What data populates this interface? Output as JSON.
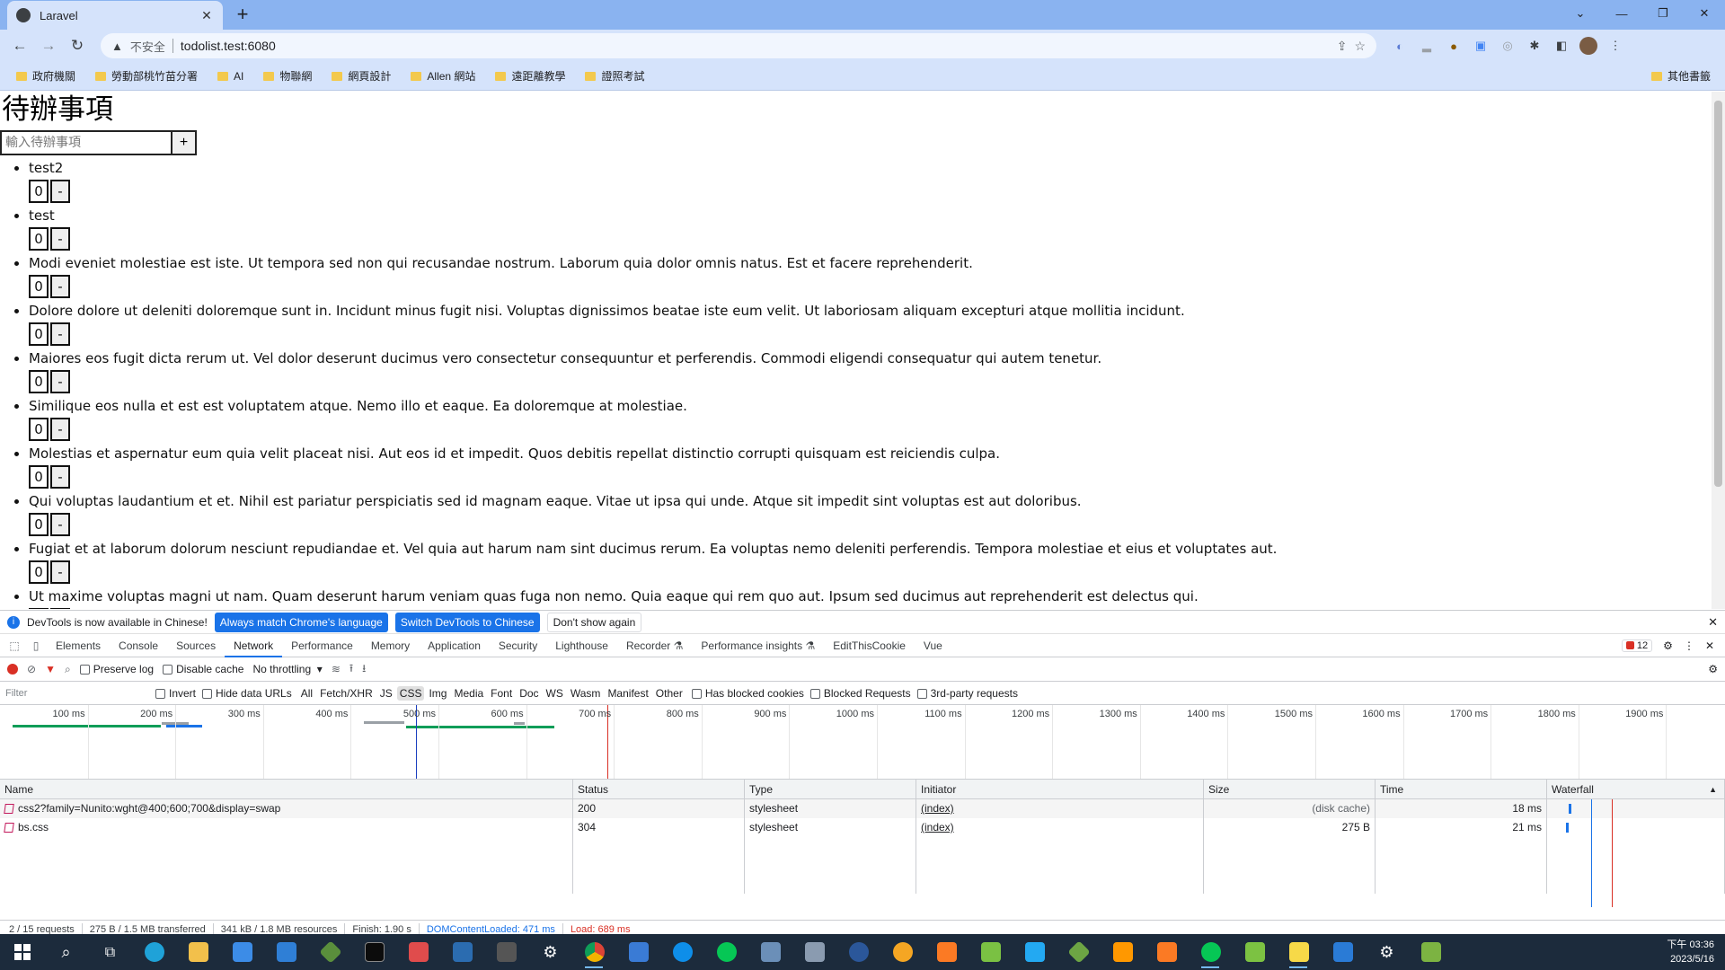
{
  "browser": {
    "tab_title": "Laravel",
    "url_security": "不安全",
    "url": "todolist.test:6080",
    "bookmarks": [
      "政府機關",
      "勞動部桃竹苗分署",
      "AI",
      "物聯網",
      "網頁設計",
      "Allen 網站",
      "遠距離教學",
      "證照考試"
    ],
    "other_bookmarks": "其他書籤"
  },
  "page": {
    "title": "待辦事項",
    "input_placeholder": "輸入待辦事項",
    "add_label": "+",
    "remove_label": "-",
    "todos": [
      {
        "text": "test2",
        "count": "0"
      },
      {
        "text": "test",
        "count": "0"
      },
      {
        "text": "Modi eveniet molestiae est iste. Ut tempora sed non qui recusandae nostrum. Laborum quia dolor omnis natus. Est et facere reprehenderit.",
        "count": "0"
      },
      {
        "text": "Dolore dolore ut deleniti doloremque sunt in. Incidunt minus fugit nisi. Voluptas dignissimos beatae iste eum velit. Ut laboriosam aliquam excepturi atque mollitia incidunt.",
        "count": "0"
      },
      {
        "text": "Maiores eos fugit dicta rerum ut. Vel dolor deserunt ducimus vero consectetur consequuntur et perferendis. Commodi eligendi consequatur qui autem tenetur.",
        "count": "0"
      },
      {
        "text": "Similique eos nulla et est est voluptatem atque. Nemo illo et eaque. Ea doloremque at molestiae.",
        "count": "0"
      },
      {
        "text": "Molestias et aspernatur eum quia velit placeat nisi. Aut eos id et impedit. Quos debitis repellat distinctio corrupti quisquam est reiciendis culpa.",
        "count": "0"
      },
      {
        "text": "Qui voluptas laudantium et et. Nihil est pariatur perspiciatis sed id magnam eaque. Vitae ut ipsa qui unde. Atque sit impedit sint voluptas est aut doloribus.",
        "count": "0"
      },
      {
        "text": "Fugiat et at laborum dolorum nesciunt repudiandae et. Vel quia aut harum nam sint ducimus rerum. Ea voluptas nemo deleniti perferendis. Tempora molestiae et eius et voluptates aut.",
        "count": "0"
      },
      {
        "text": "Ut maxime voluptas magni ut nam. Quam deserunt harum veniam quas fuga non nemo. Quia eaque qui rem quo aut. Ipsum sed ducimus aut reprehenderit est delectus qui.",
        "count": "0"
      }
    ]
  },
  "devtools": {
    "info_text": "DevTools is now available in Chinese!",
    "btn_match": "Always match Chrome's language",
    "btn_switch": "Switch DevTools to Chinese",
    "btn_dont": "Don't show again",
    "tabs": [
      "Elements",
      "Console",
      "Sources",
      "Network",
      "Performance",
      "Memory",
      "Application",
      "Security",
      "Lighthouse",
      "Recorder ⚗",
      "Performance insights ⚗",
      "EditThisCookie",
      "Vue"
    ],
    "active_tab": "Network",
    "error_count": "12",
    "preserve_log": "Preserve log",
    "disable_cache": "Disable cache",
    "throttling": "No throttling",
    "filter_placeholder": "Filter",
    "invert": "Invert",
    "hide_data_urls": "Hide data URLs",
    "types": [
      "All",
      "Fetch/XHR",
      "JS",
      "CSS",
      "Img",
      "Media",
      "Font",
      "Doc",
      "WS",
      "Wasm",
      "Manifest",
      "Other"
    ],
    "active_type": "CSS",
    "has_blocked_cookies": "Has blocked cookies",
    "blocked_requests": "Blocked Requests",
    "third_party": "3rd-party requests",
    "timeline_ticks": [
      "100 ms",
      "200 ms",
      "300 ms",
      "400 ms",
      "500 ms",
      "600 ms",
      "700 ms",
      "800 ms",
      "900 ms",
      "1000 ms",
      "1100 ms",
      "1200 ms",
      "1300 ms",
      "1400 ms",
      "1500 ms",
      "1600 ms",
      "1700 ms",
      "1800 ms",
      "1900 ms",
      "200"
    ],
    "columns": [
      "Name",
      "Status",
      "Type",
      "Initiator",
      "Size",
      "Time",
      "Waterfall"
    ],
    "rows": [
      {
        "name": "css2?family=Nunito:wght@400;600;700&display=swap",
        "status": "200",
        "type": "stylesheet",
        "initiator": "(index)",
        "size": "(disk cache)",
        "time": "18 ms"
      },
      {
        "name": "bs.css",
        "status": "304",
        "type": "stylesheet",
        "initiator": "(index)",
        "size": "275 B",
        "time": "21 ms"
      }
    ],
    "status": {
      "requests": "2 / 15 requests",
      "transferred": "275 B / 1.5 MB transferred",
      "resources": "341 kB / 1.8 MB resources",
      "finish": "Finish: 1.90 s",
      "dcl": "DOMContentLoaded: 471 ms",
      "load": "Load: 689 ms"
    }
  },
  "taskbar": {
    "time": "下午 03:36",
    "date": "2023/5/16"
  },
  "colors": {
    "chrome_frame": "#8ab3f0",
    "accent": "#1a73e8",
    "error": "#d93025"
  }
}
